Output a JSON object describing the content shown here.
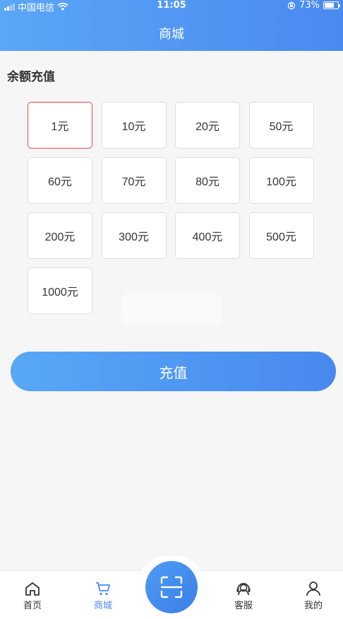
{
  "status": {
    "carrier": "中国电信",
    "time": "11:05",
    "battery": "73%",
    "battery_level": 0.73
  },
  "header": {
    "title": "商城"
  },
  "section": {
    "title": "余额充值"
  },
  "options": [
    "1元",
    "10元",
    "20元",
    "50元",
    "60元",
    "70元",
    "80元",
    "100元",
    "200元",
    "300元",
    "400元",
    "500元",
    "1000元"
  ],
  "selected_index": 0,
  "recharge_label": "充值",
  "tabs": [
    {
      "label": "首页",
      "icon": "home-icon"
    },
    {
      "label": "商城",
      "icon": "cart-icon"
    },
    {
      "label": "客服",
      "icon": "headset-icon"
    },
    {
      "label": "我的",
      "icon": "user-icon"
    }
  ],
  "active_tab": 1,
  "colors": {
    "accent": "#4a8af0",
    "selected_border": "#e04848"
  }
}
